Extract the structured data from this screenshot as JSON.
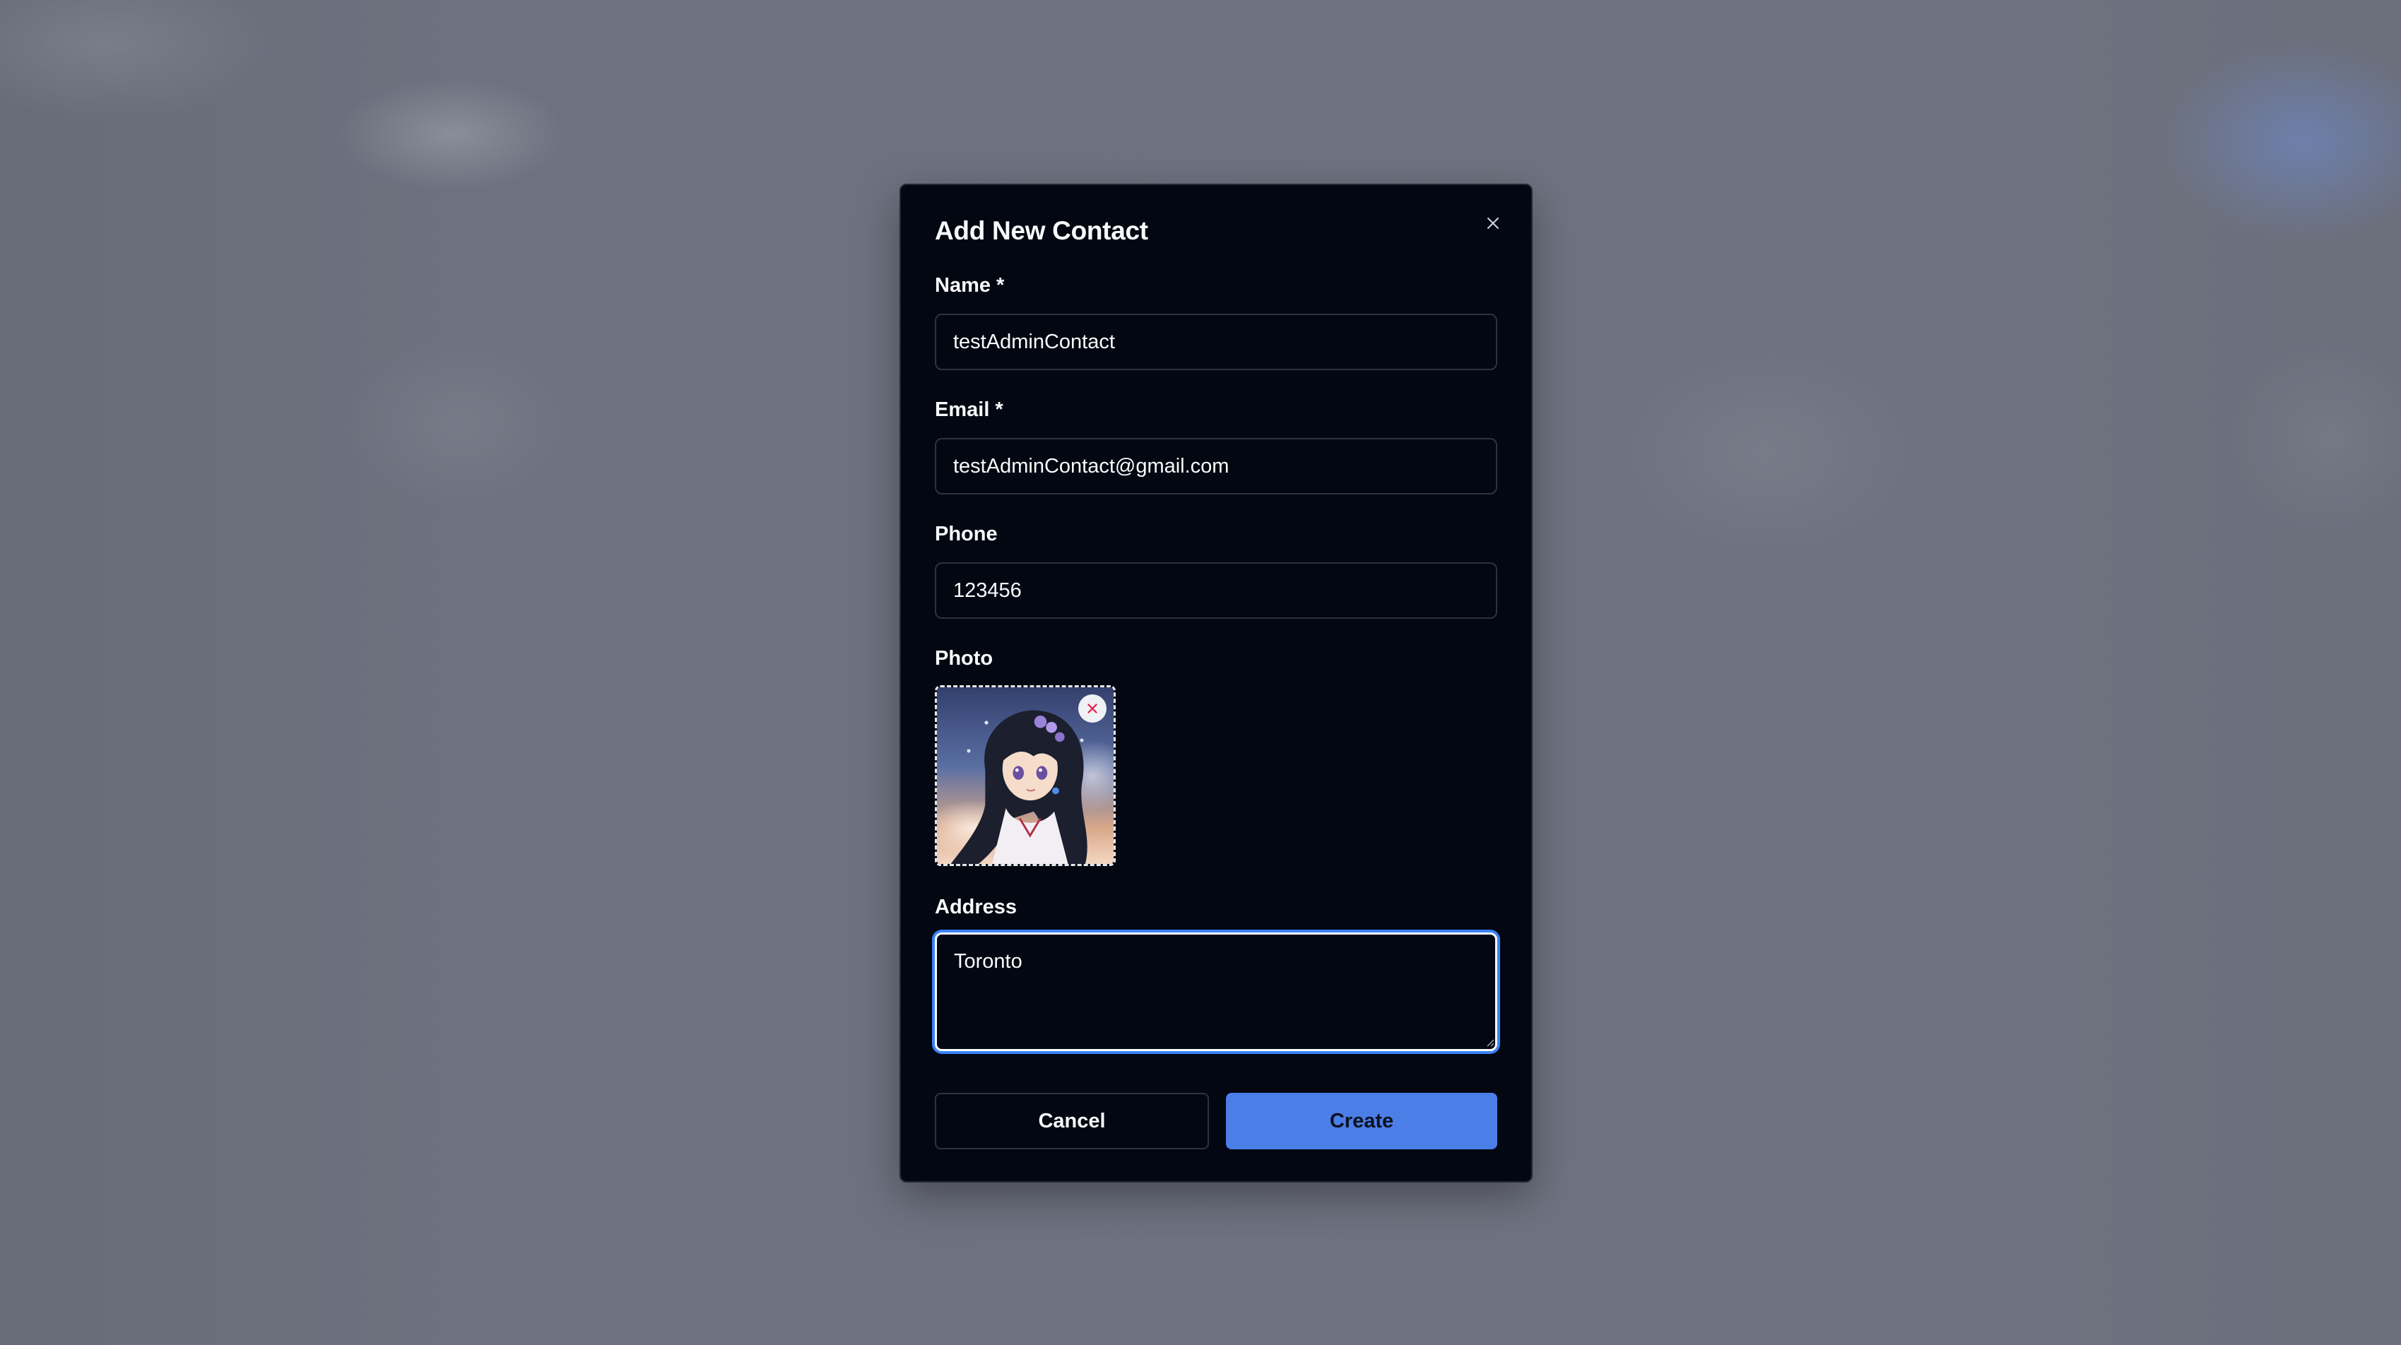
{
  "dialog": {
    "title": "Add New Contact",
    "close_icon": "close-icon"
  },
  "form": {
    "name": {
      "label": "Name *",
      "value": "testAdminContact"
    },
    "email": {
      "label": "Email *",
      "value": "testAdminContact@gmail.com"
    },
    "phone": {
      "label": "Phone",
      "value": "123456"
    },
    "photo": {
      "label": "Photo",
      "remove_icon": "close-icon"
    },
    "address": {
      "label": "Address",
      "value": "Toronto"
    }
  },
  "actions": {
    "cancel_label": "Cancel",
    "create_label": "Create"
  },
  "colors": {
    "modal_background": "#030712",
    "primary_button": "#4c7ee8",
    "focus_ring": "#3b82f6",
    "overlay": "#6e7280",
    "remove_icon": "#e11d48"
  }
}
